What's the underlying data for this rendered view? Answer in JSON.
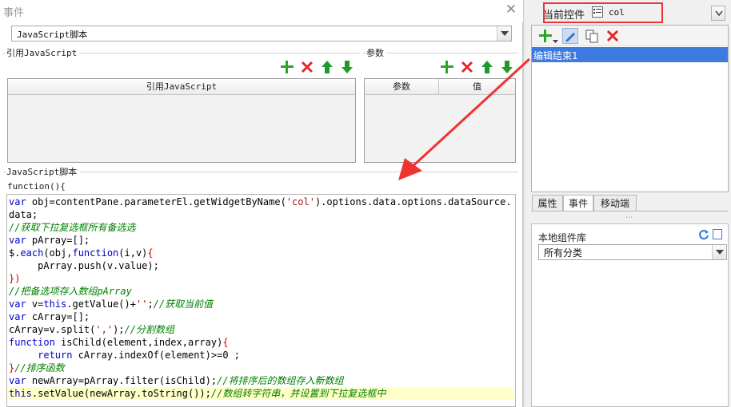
{
  "dialog": {
    "title": "事件",
    "script_type_value": "JavaScript脚本",
    "ref_js_section_label": "引用JavaScript",
    "params_section_label": "参数",
    "ref_js_table_header": "引用JavaScript",
    "params_table_headers": [
      "参数",
      "值"
    ],
    "js_section_label": "JavaScript脚本",
    "function_header": "function(){",
    "code_lines": [
      "var obj=contentPane.parameterEl.getWidgetByName('col').options.data.options.dataSource.",
      "data;",
      "//获取下拉复选框所有备选选",
      "var pArray=[];",
      "$.each(obj,function(i,v){",
      "     pArray.push(v.value);",
      "})",
      "//把备选项存入数组pArray",
      "var v=this.getValue()+'';//获取当前值",
      "var cArray=[];",
      "cArray=v.split(',');//分割数组",
      "function isChild(element,index,array){",
      "     return cArray.indexOf(element)>=0 ;",
      "}//排序函数",
      "var newArray=pArray.filter(isChild);//将排序后的数组存入新数组",
      "this.setValue(newArray.toString());//数组转字符串，并设置到下拉复选框中"
    ]
  },
  "right_panel": {
    "current_widget_label": "当前控件",
    "current_widget_value": "col",
    "event_list": [
      "编辑结束1"
    ],
    "tabs": [
      "属性",
      "事件",
      "移动端"
    ],
    "active_tab": "事件",
    "local_lib_label": "本地组件库",
    "category_value": "所有分类",
    "colors": {
      "selected_row": "#3d7be0",
      "highlight_box": "#e33333"
    }
  }
}
